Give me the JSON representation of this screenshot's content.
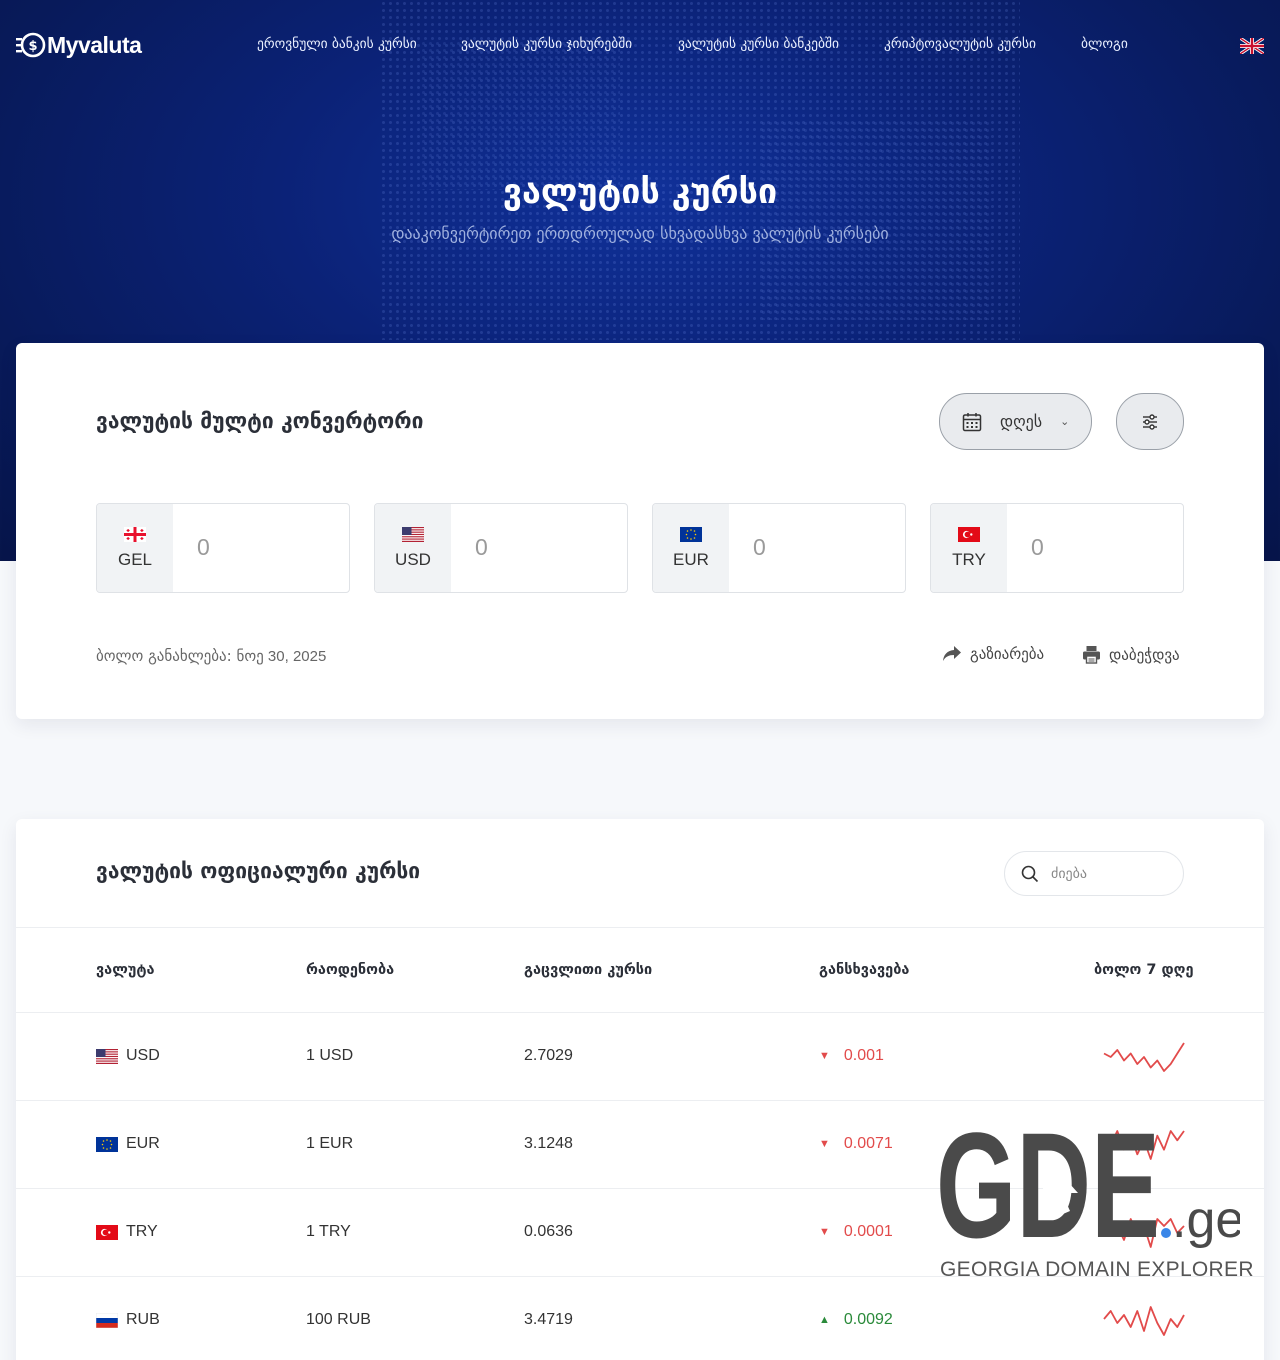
{
  "header": {
    "logo_text": "Myvaluta",
    "nav": [
      {
        "label": "ეროვნული ბანკის კურსი"
      },
      {
        "label": "ვალუტის კურსი ჯიხურებში"
      },
      {
        "label": "ვალუტის კურსი ბანკებში"
      },
      {
        "label": "კრიპტოვალუტის კურსი"
      },
      {
        "label": "ბლოგი"
      }
    ],
    "language_flag": "uk-flag-icon"
  },
  "hero": {
    "title": "ვალუტის კურსი",
    "subtitle": "დააკონვერტირეთ ერთდროულად სხვადასხვა ვალუტის კურსები"
  },
  "converter": {
    "title": "ვალუტის მულტი კონვერტორი",
    "date_label": "დღეს",
    "currencies": [
      {
        "code": "GEL",
        "value": "0"
      },
      {
        "code": "USD",
        "value": "0"
      },
      {
        "code": "EUR",
        "value": "0"
      },
      {
        "code": "TRY",
        "value": "0"
      }
    ],
    "updated_label": "ბოლო განახლება:",
    "updated_date": "ნოე 30, 2025",
    "share_label": "გაზიარება",
    "print_label": "დაბეჭდვა"
  },
  "rates": {
    "title": "ვალუტის ოფიციალური კურსი",
    "search_placeholder": "ძიება",
    "columns": {
      "currency": "ვალუტა",
      "quantity": "რაოდენობა",
      "rate": "გაცვლითი კურსი",
      "diff": "განსხვავება",
      "last7": "ბოლო 7 დღე"
    },
    "rows": [
      {
        "code": "USD",
        "quantity": "1 USD",
        "rate": "2.7029",
        "diff": "0.001",
        "direction": "down",
        "spark": [
          5,
          4,
          6,
          3,
          5,
          2,
          4,
          1,
          3,
          0,
          2,
          5,
          8
        ]
      },
      {
        "code": "EUR",
        "quantity": "1 EUR",
        "rate": "3.1248",
        "diff": "0.0071",
        "direction": "down",
        "spark": [
          5,
          3,
          6,
          2,
          5,
          1,
          4,
          0,
          5,
          2,
          6,
          4,
          6
        ]
      },
      {
        "code": "TRY",
        "quantity": "1 TRY",
        "rate": "0.0636",
        "diff": "0.0001",
        "direction": "down",
        "spark": [
          6,
          4,
          5,
          3,
          6,
          4,
          5,
          2,
          6,
          5,
          6,
          4,
          5
        ]
      },
      {
        "code": "RUB",
        "quantity": "100 RUB",
        "rate": "3.4719",
        "diff": "0.0092",
        "direction": "up",
        "spark": [
          4,
          6,
          3,
          5,
          2,
          6,
          1,
          7,
          3,
          0,
          4,
          2,
          5
        ]
      }
    ],
    "down_color": "#e24b4b",
    "up_color": "#2a8a3a"
  },
  "watermark": {
    "brand": "GDE",
    "tld": ".ge",
    "tagline": "GEORGIA DOMAIN EXPLORER"
  }
}
